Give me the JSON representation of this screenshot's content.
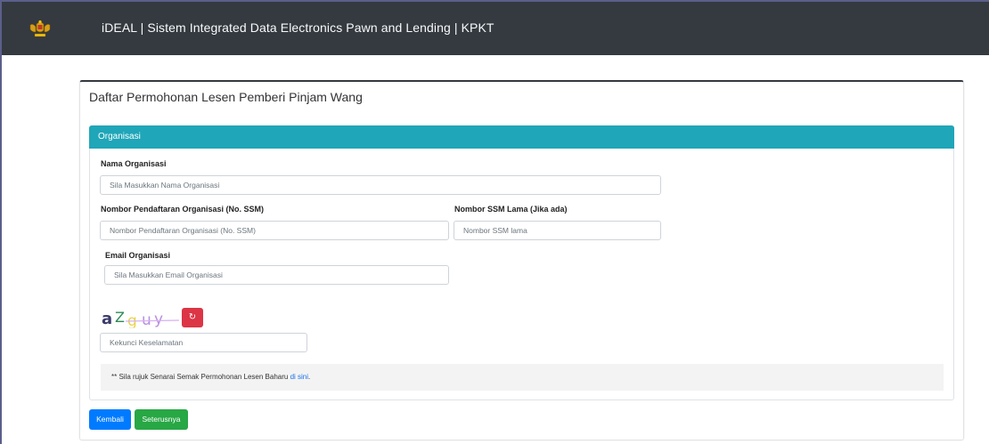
{
  "header": {
    "title": "iDEAL | Sistem Integrated Data Electronics Pawn and Lending | KPKT",
    "logo_icon": "malaysia-coat-of-arms"
  },
  "form": {
    "title": "Daftar Permohonan Lesen Pemberi Pinjam Wang",
    "section_title": "Organisasi",
    "nama_organisasi": {
      "label": "Nama Organisasi",
      "placeholder": "Sila Masukkan Nama Organisasi"
    },
    "no_ssm": {
      "label": "Nombor Pendaftaran Organisasi (No. SSM)",
      "placeholder": "Nombor Pendaftaran Organisasi (No. SSM)"
    },
    "ssm_lama": {
      "label": "Nombor SSM Lama (Jika ada)",
      "placeholder": "Nombor SSM lama"
    },
    "email": {
      "label": "Email Organisasi",
      "placeholder": "Sila Masukkan Email Organisasi"
    },
    "captcha": {
      "text": "aZguy",
      "refresh_icon": "refresh-icon",
      "placeholder": "Kekunci Keselamatan"
    },
    "note": {
      "text": "** Sila rujuk Senarai Semak Permohonan Lesen Baharu ",
      "link": "di sini",
      "suffix": "."
    }
  },
  "buttons": {
    "back": "Kembali",
    "next": "Seterusnya"
  },
  "colors": {
    "topbar": "#343a40",
    "section_header": "#1fa6b8",
    "back_button": "#007bff",
    "next_button": "#28a745",
    "refresh_button": "#dc3545"
  }
}
